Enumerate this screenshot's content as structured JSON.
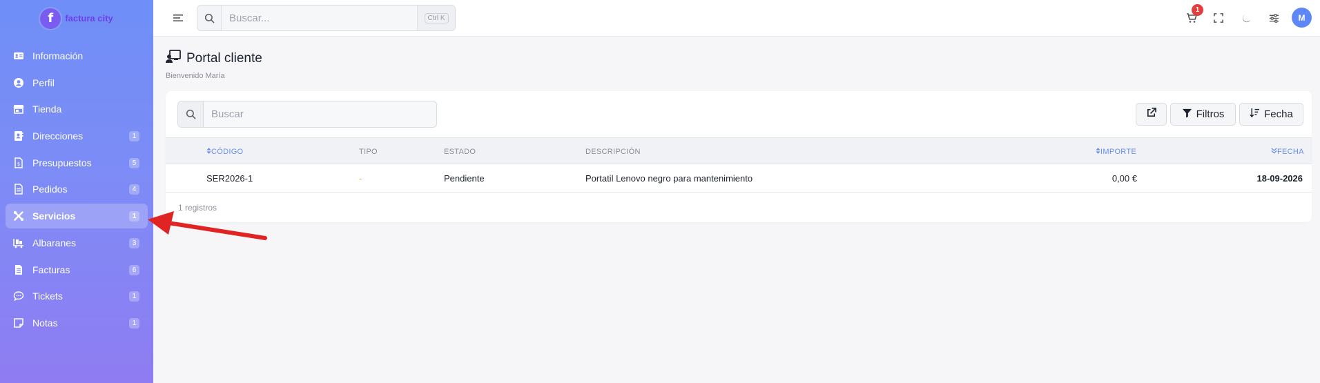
{
  "brand": {
    "name": "factura city",
    "logo_letter": "f",
    "logo_color": "#7b5cf0"
  },
  "sidebar": {
    "items": [
      {
        "label": "Información",
        "icon": "id-card-icon",
        "badge": ""
      },
      {
        "label": "Perfil",
        "icon": "user-circle-icon",
        "badge": ""
      },
      {
        "label": "Tienda",
        "icon": "store-icon",
        "badge": ""
      },
      {
        "label": "Direcciones",
        "icon": "address-book-icon",
        "badge": "1"
      },
      {
        "label": "Presupuestos",
        "icon": "file-invoice-icon",
        "badge": "5"
      },
      {
        "label": "Pedidos",
        "icon": "file-icon",
        "badge": "4"
      },
      {
        "label": "Servicios",
        "icon": "tools-icon",
        "badge": "1",
        "active": true
      },
      {
        "label": "Albaranes",
        "icon": "dolly-icon",
        "badge": "3"
      },
      {
        "label": "Facturas",
        "icon": "file-lines-icon",
        "badge": "6"
      },
      {
        "label": "Tickets",
        "icon": "chat-icon",
        "badge": "1"
      },
      {
        "label": "Notas",
        "icon": "sticky-note-icon",
        "badge": "1"
      }
    ]
  },
  "topbar": {
    "search_placeholder": "Buscar...",
    "shortcut": "Ctrl K",
    "cart_count": "1",
    "avatar_initial": "M"
  },
  "page": {
    "title": "Portal cliente",
    "subtitle": "Bienvenido María"
  },
  "table": {
    "search_placeholder": "Buscar",
    "buttons": {
      "filters": "Filtros",
      "date": "Fecha"
    },
    "columns": {
      "code": "CÓDIGO",
      "type": "TIPO",
      "status": "ESTADO",
      "description": "DESCRIPCIÓN",
      "amount": "IMPORTE",
      "date": "FECHA"
    },
    "rows": [
      {
        "code": "SER2026-1",
        "type": "-",
        "status": "Pendiente",
        "description": "Portatil Lenovo negro para mantenimiento",
        "amount": "0,00 €",
        "date": "18-09-2026"
      }
    ],
    "record_count": "1 registros"
  },
  "colors": {
    "accent": "#6a8cf0",
    "arrow": "#e02424",
    "badge_red": "#e23e3e"
  }
}
